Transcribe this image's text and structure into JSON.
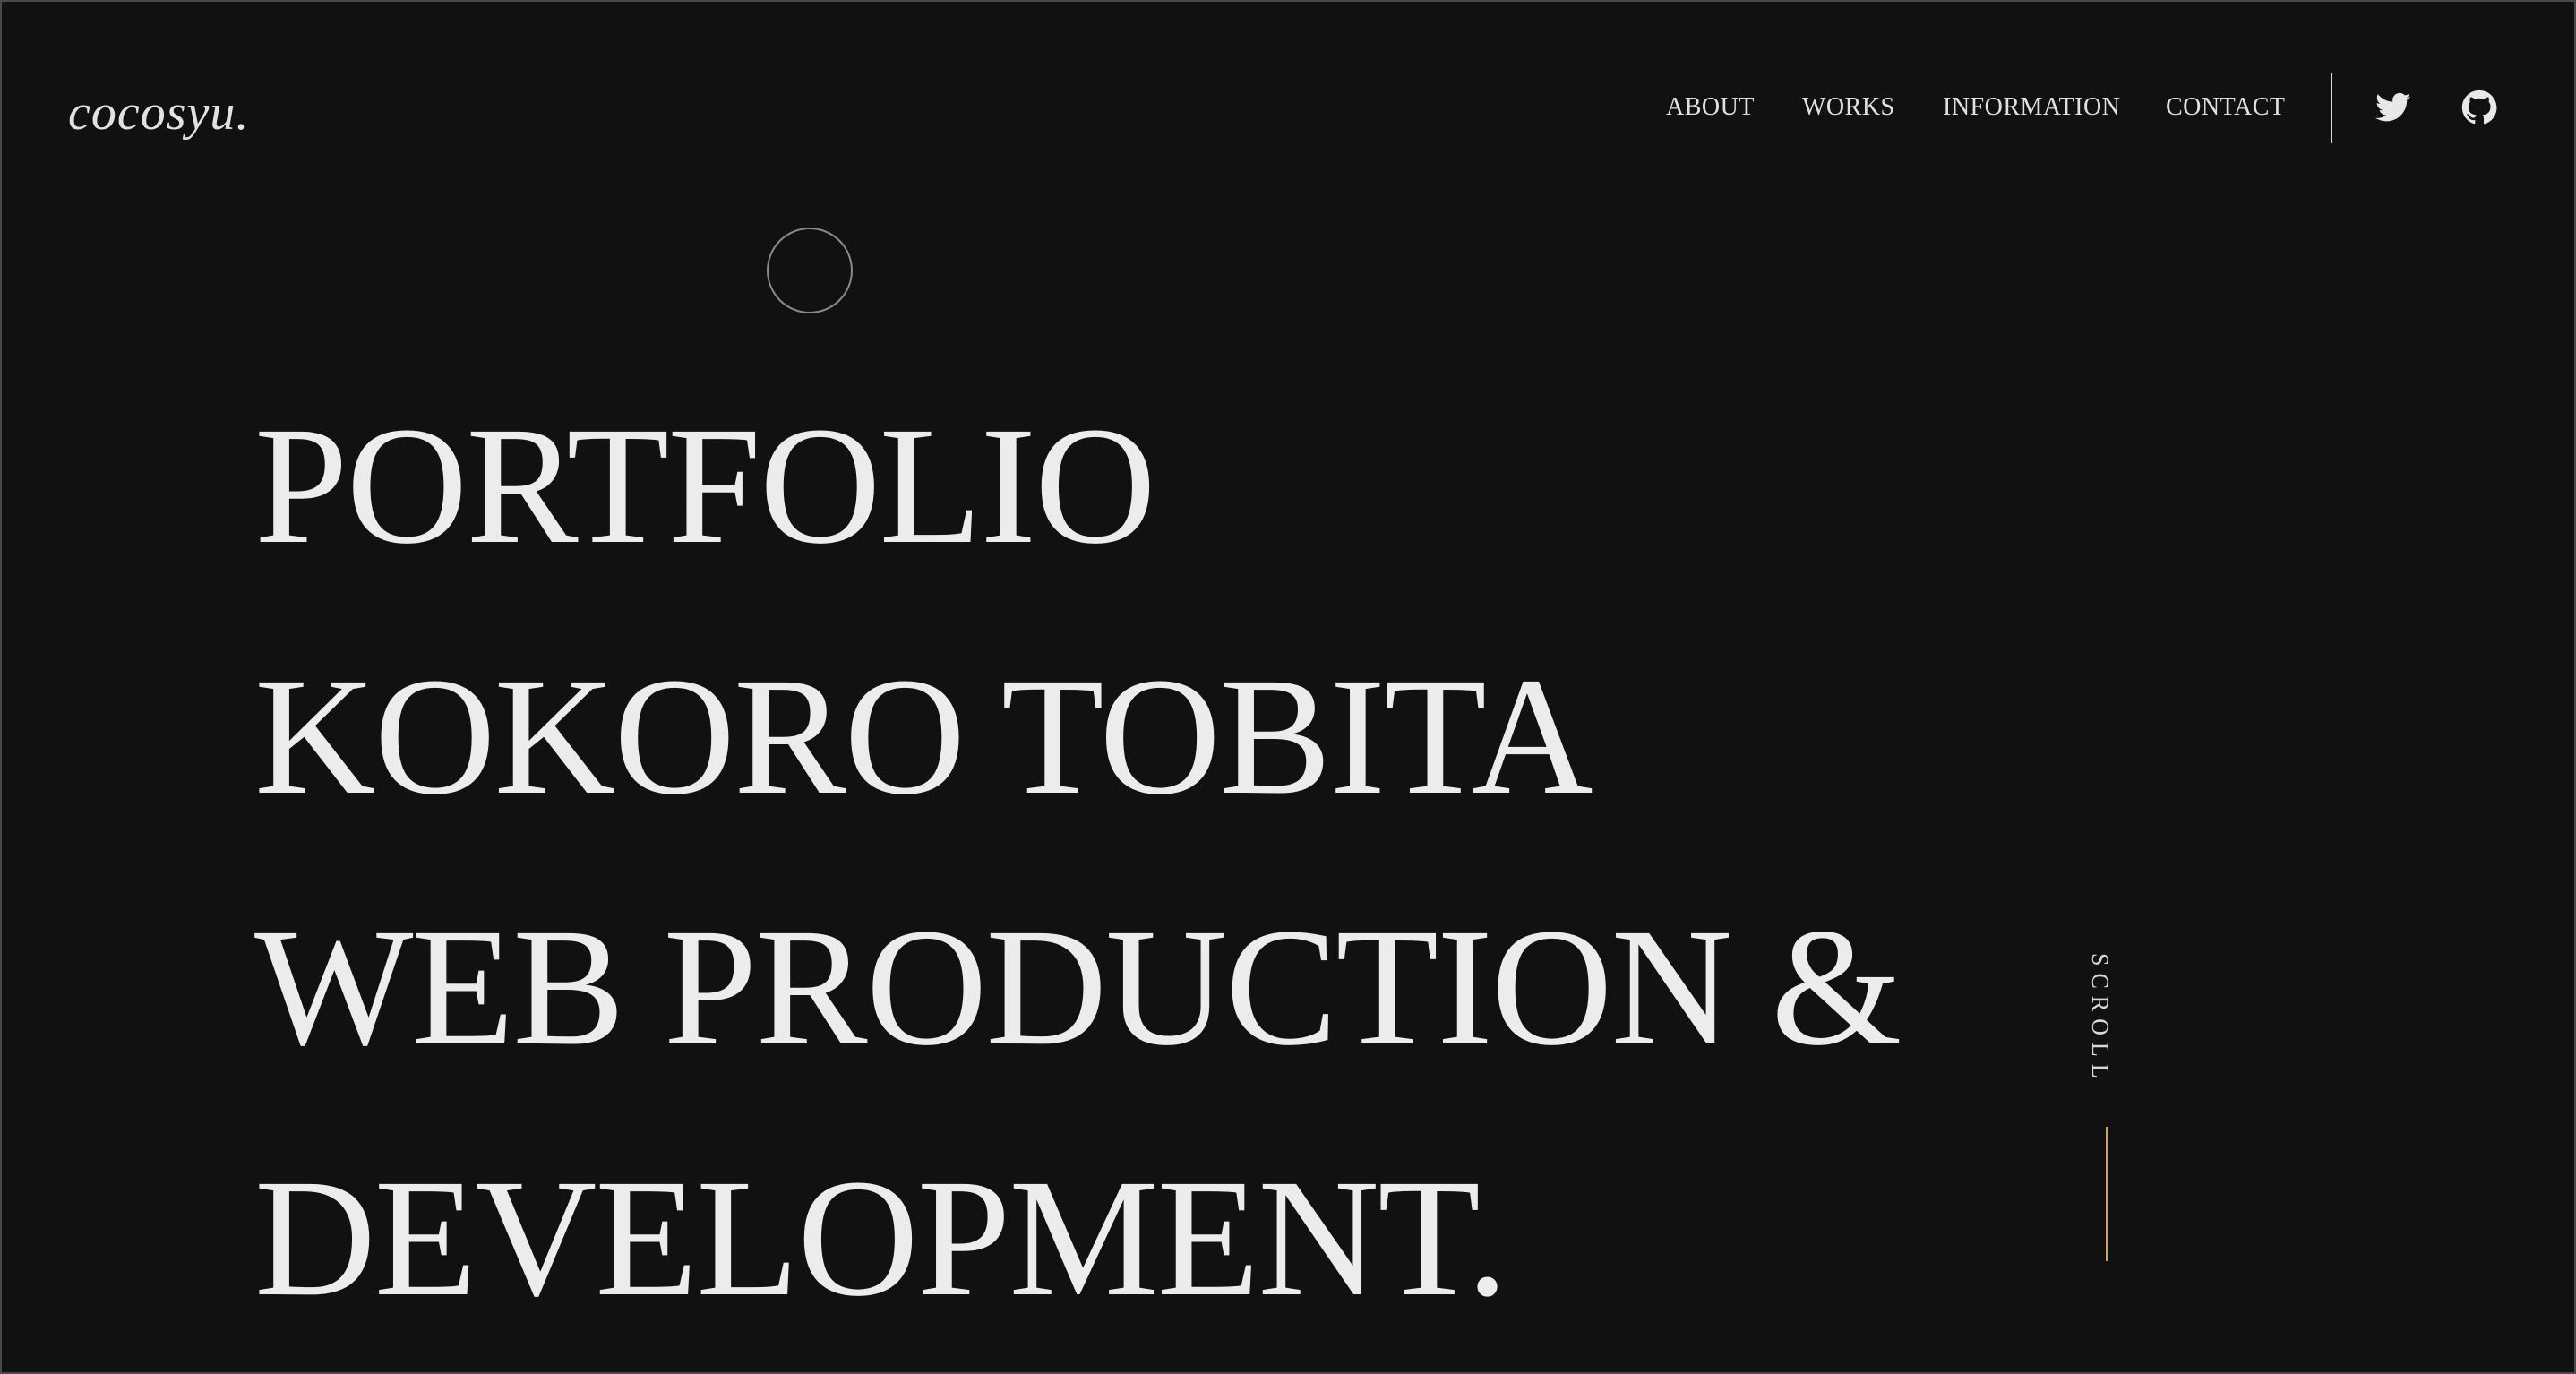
{
  "header": {
    "logo": "cocosyu.",
    "nav": [
      {
        "label": "ABOUT"
      },
      {
        "label": "WORKS"
      },
      {
        "label": "INFORMATION"
      },
      {
        "label": "CONTACT"
      }
    ],
    "social": [
      {
        "icon": "twitter-icon"
      },
      {
        "icon": "github-icon"
      }
    ]
  },
  "hero": {
    "lines": [
      "PORTFOLIO",
      "KOKORO TOBITA",
      "WEB PRODUCTION &",
      "DEVELOPMENT."
    ]
  },
  "scroll": {
    "label": "SCROLL"
  },
  "colors": {
    "background": "#111111",
    "text": "#e8e8e8",
    "accent": "#c9a467"
  }
}
